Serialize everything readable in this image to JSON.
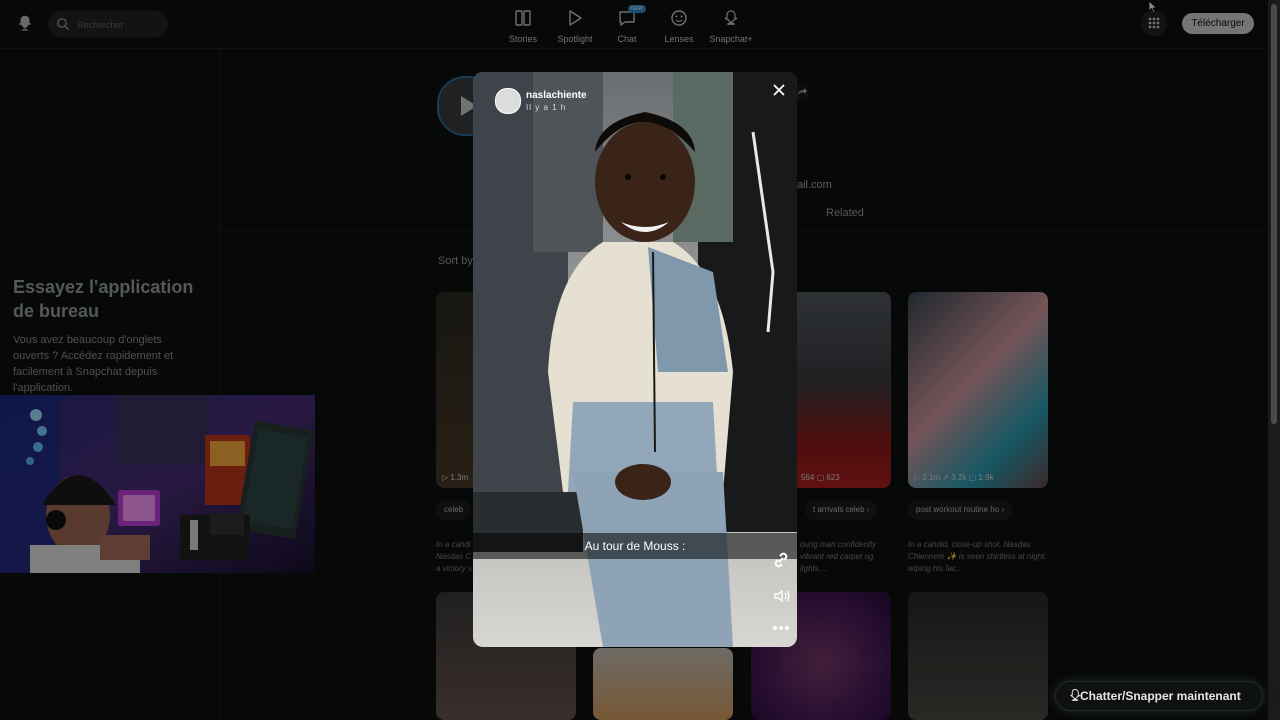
{
  "header": {
    "search_placeholder": "Rechercher",
    "nav": [
      {
        "label": "Stories",
        "icon": "stories-icon"
      },
      {
        "label": "Spotlight",
        "icon": "spotlight-icon"
      },
      {
        "label": "Chat",
        "icon": "chat-icon",
        "badge": "NEW"
      },
      {
        "label": "Lenses",
        "icon": "lenses-icon"
      },
      {
        "label": "Snapchat+",
        "icon": "snapchat-plus-icon"
      }
    ],
    "download_label": "Télécharger"
  },
  "sidebar": {
    "promo_title": "Essayez l'application de bureau",
    "promo_text": "Vous avez beaucoup d'onglets ouverts ? Accédez rapidement et facilement à Snapchat depuis l'application."
  },
  "profile": {
    "email_fragment": "ail.com",
    "related_tab": "Related",
    "sort_label": "Sort by"
  },
  "cards": [
    {
      "stats": "▷ 1.3m",
      "chip": "celeb",
      "desc": "In a candi Nasdas C a victory s"
    },
    {
      "stats": "564  ▢ 623",
      "chip": "t arrivals   celeb ›",
      "desc": "oung man confidently vibrant red carpet ng lights...."
    },
    {
      "stats": "▷ 2.1m  ⇗ 3.2k  ▢ 1.9k",
      "chip": "post workout routine   ho ›",
      "desc": "In a candid, close-up shot, Nasdas Chienneté ✨ is seen shirtless at night, wiping his fac..."
    }
  ],
  "viewer": {
    "username": "naslachiente",
    "time": "Il y a 1 h",
    "caption": "Au tour de Mouss :"
  },
  "chat_button": "Chatter/Snapper maintenant"
}
